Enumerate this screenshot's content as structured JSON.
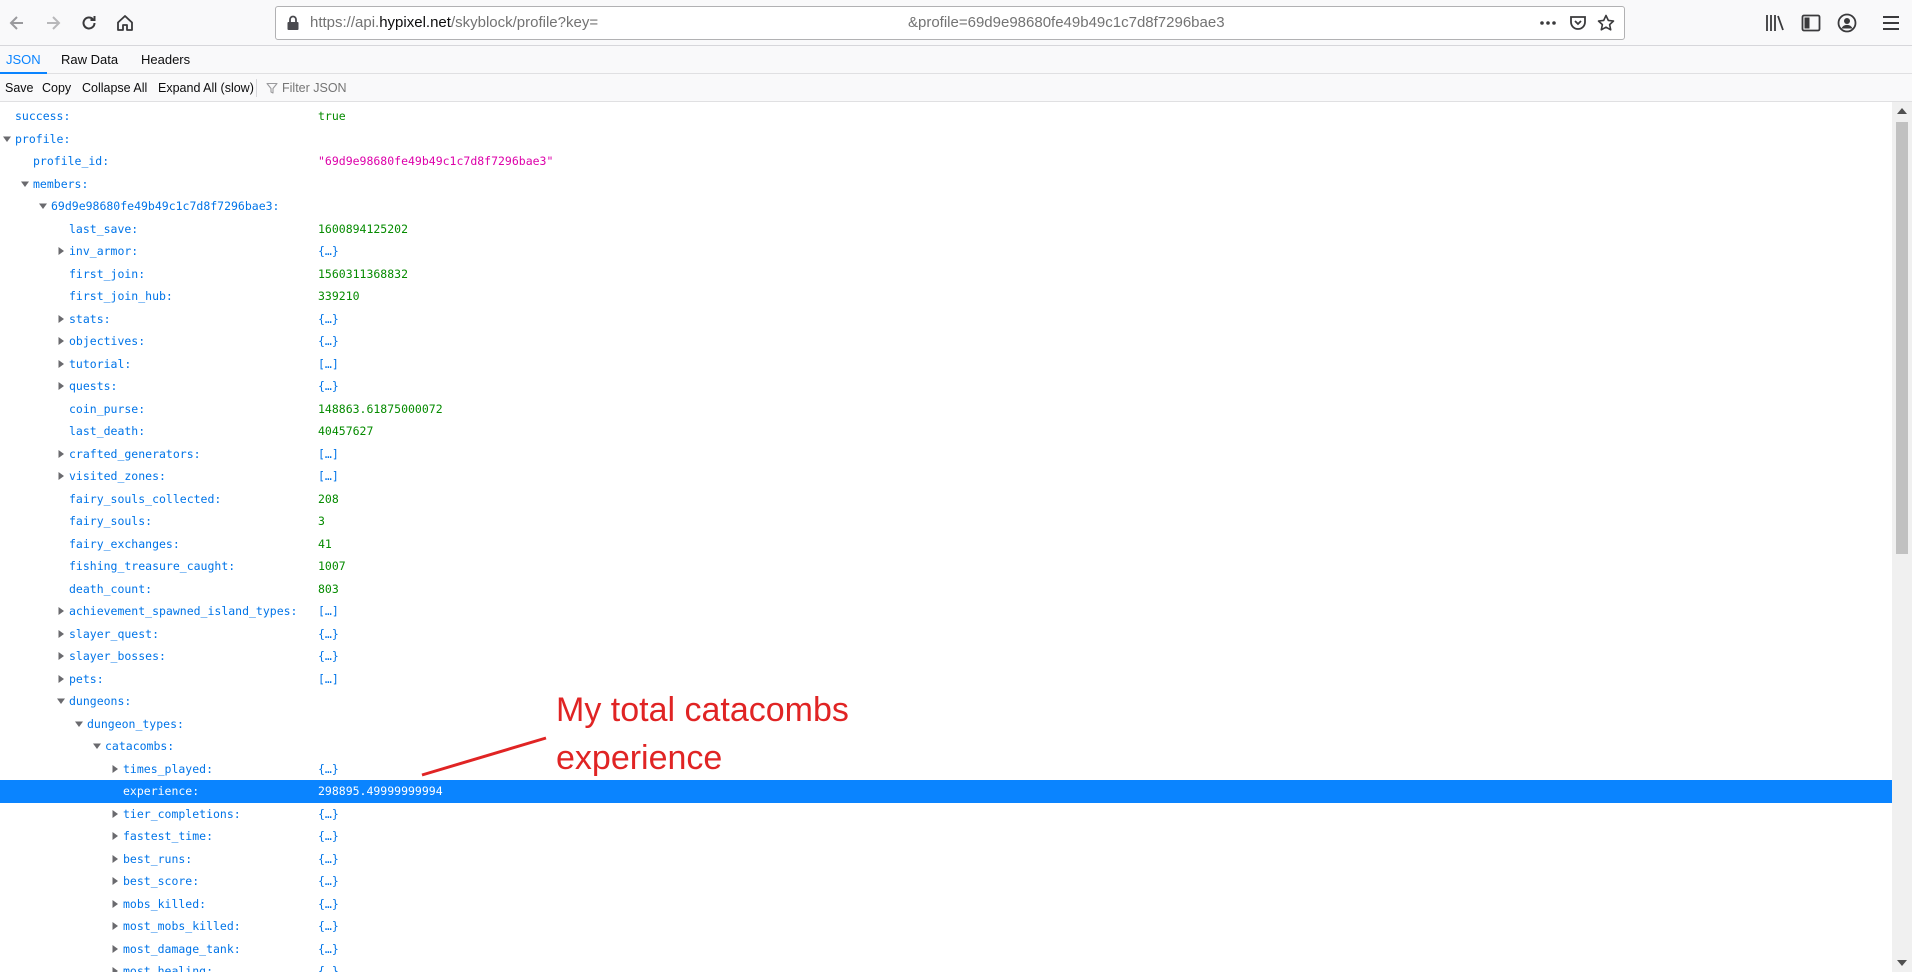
{
  "browser": {
    "url_prefix": "https://api.",
    "url_host": "hypixel.net",
    "url_path": "/skyblock/profile?key=",
    "url_suffix": "&profile=69d9e98680fe49b49c1c7d8f7296bae3"
  },
  "viewer": {
    "tabs": [
      "JSON",
      "Raw Data",
      "Headers"
    ],
    "actions": [
      "Save",
      "Copy",
      "Collapse All",
      "Expand All (slow)"
    ],
    "filter_placeholder": "Filter JSON"
  },
  "tree": [
    {
      "key": "success:",
      "value": "true",
      "type": "bool",
      "depth": 0,
      "twisty": "none"
    },
    {
      "key": "profile:",
      "value": "",
      "type": "none",
      "depth": 0,
      "twisty": "open"
    },
    {
      "key": "profile_id:",
      "value": "\"69d9e98680fe49b49c1c7d8f7296bae3\"",
      "type": "str",
      "depth": 1,
      "twisty": "none"
    },
    {
      "key": "members:",
      "value": "",
      "type": "none",
      "depth": 1,
      "twisty": "open"
    },
    {
      "key": "69d9e98680fe49b49c1c7d8f7296bae3:",
      "value": "",
      "type": "none",
      "depth": 2,
      "twisty": "open"
    },
    {
      "key": "last_save:",
      "value": "1600894125202",
      "type": "num",
      "depth": 3,
      "twisty": "none"
    },
    {
      "key": "inv_armor:",
      "value": "{…}",
      "type": "coll",
      "depth": 3,
      "twisty": "closed"
    },
    {
      "key": "first_join:",
      "value": "1560311368832",
      "type": "num",
      "depth": 3,
      "twisty": "none"
    },
    {
      "key": "first_join_hub:",
      "value": "339210",
      "type": "num",
      "depth": 3,
      "twisty": "none"
    },
    {
      "key": "stats:",
      "value": "{…}",
      "type": "coll",
      "depth": 3,
      "twisty": "closed"
    },
    {
      "key": "objectives:",
      "value": "{…}",
      "type": "coll",
      "depth": 3,
      "twisty": "closed"
    },
    {
      "key": "tutorial:",
      "value": "[…]",
      "type": "coll",
      "depth": 3,
      "twisty": "closed"
    },
    {
      "key": "quests:",
      "value": "{…}",
      "type": "coll",
      "depth": 3,
      "twisty": "closed"
    },
    {
      "key": "coin_purse:",
      "value": "148863.61875000072",
      "type": "num",
      "depth": 3,
      "twisty": "none"
    },
    {
      "key": "last_death:",
      "value": "40457627",
      "type": "num",
      "depth": 3,
      "twisty": "none"
    },
    {
      "key": "crafted_generators:",
      "value": "[…]",
      "type": "coll",
      "depth": 3,
      "twisty": "closed"
    },
    {
      "key": "visited_zones:",
      "value": "[…]",
      "type": "coll",
      "depth": 3,
      "twisty": "closed"
    },
    {
      "key": "fairy_souls_collected:",
      "value": "208",
      "type": "num",
      "depth": 3,
      "twisty": "none"
    },
    {
      "key": "fairy_souls:",
      "value": "3",
      "type": "num",
      "depth": 3,
      "twisty": "none"
    },
    {
      "key": "fairy_exchanges:",
      "value": "41",
      "type": "num",
      "depth": 3,
      "twisty": "none"
    },
    {
      "key": "fishing_treasure_caught:",
      "value": "1007",
      "type": "num",
      "depth": 3,
      "twisty": "none"
    },
    {
      "key": "death_count:",
      "value": "803",
      "type": "num",
      "depth": 3,
      "twisty": "none"
    },
    {
      "key": "achievement_spawned_island_types:",
      "value": "[…]",
      "type": "coll",
      "depth": 3,
      "twisty": "closed"
    },
    {
      "key": "slayer_quest:",
      "value": "{…}",
      "type": "coll",
      "depth": 3,
      "twisty": "closed"
    },
    {
      "key": "slayer_bosses:",
      "value": "{…}",
      "type": "coll",
      "depth": 3,
      "twisty": "closed"
    },
    {
      "key": "pets:",
      "value": "[…]",
      "type": "coll",
      "depth": 3,
      "twisty": "closed"
    },
    {
      "key": "dungeons:",
      "value": "",
      "type": "none",
      "depth": 3,
      "twisty": "open"
    },
    {
      "key": "dungeon_types:",
      "value": "",
      "type": "none",
      "depth": 4,
      "twisty": "open"
    },
    {
      "key": "catacombs:",
      "value": "",
      "type": "none",
      "depth": 5,
      "twisty": "open"
    },
    {
      "key": "times_played:",
      "value": "{…}",
      "type": "coll",
      "depth": 6,
      "twisty": "closed"
    },
    {
      "key": "experience:",
      "value": "298895.49999999994",
      "type": "num",
      "depth": 6,
      "twisty": "none",
      "selected": true
    },
    {
      "key": "tier_completions:",
      "value": "{…}",
      "type": "coll",
      "depth": 6,
      "twisty": "closed"
    },
    {
      "key": "fastest_time:",
      "value": "{…}",
      "type": "coll",
      "depth": 6,
      "twisty": "closed"
    },
    {
      "key": "best_runs:",
      "value": "{…}",
      "type": "coll",
      "depth": 6,
      "twisty": "closed"
    },
    {
      "key": "best_score:",
      "value": "{…}",
      "type": "coll",
      "depth": 6,
      "twisty": "closed"
    },
    {
      "key": "mobs_killed:",
      "value": "{…}",
      "type": "coll",
      "depth": 6,
      "twisty": "closed"
    },
    {
      "key": "most_mobs_killed:",
      "value": "{…}",
      "type": "coll",
      "depth": 6,
      "twisty": "closed"
    },
    {
      "key": "most_damage_tank:",
      "value": "{…}",
      "type": "coll",
      "depth": 6,
      "twisty": "closed"
    },
    {
      "key": "most_healing:",
      "value": "{…}",
      "type": "coll",
      "depth": 6,
      "twisty": "closed"
    }
  ],
  "annotation": {
    "text": "My total catacombs experience",
    "color": "#e02424"
  }
}
